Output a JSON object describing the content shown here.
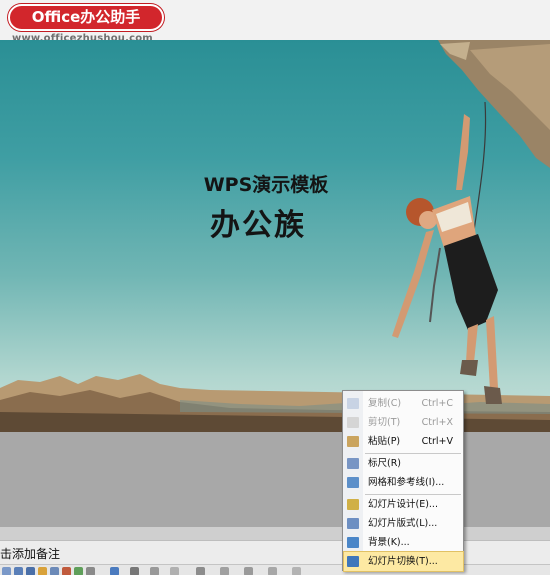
{
  "watermark": {
    "badge": "Office办公助手",
    "url": "www.officezhushou.com"
  },
  "slide": {
    "title": "WPS演示模板",
    "subtitle": "办公族"
  },
  "notes": {
    "placeholder": "击添加备注"
  },
  "context_menu": {
    "items": [
      {
        "label": "复制(C)",
        "shortcut": "Ctrl+C",
        "enabled": false,
        "icon": "copy-icon"
      },
      {
        "label": "剪切(T)",
        "shortcut": "Ctrl+X",
        "enabled": false,
        "icon": "cut-icon"
      },
      {
        "label": "粘贴(P)",
        "shortcut": "Ctrl+V",
        "enabled": true,
        "icon": "paste-icon"
      },
      {
        "label": "标尺(R)",
        "shortcut": "",
        "enabled": true,
        "icon": "ruler-icon"
      },
      {
        "label": "网格和参考线(I)...",
        "shortcut": "",
        "enabled": true,
        "icon": "grid-icon"
      },
      {
        "label": "幻灯片设计(E)...",
        "shortcut": "",
        "enabled": true,
        "icon": "slide-design-icon"
      },
      {
        "label": "幻灯片版式(L)...",
        "shortcut": "",
        "enabled": true,
        "icon": "slide-layout-icon"
      },
      {
        "label": "背景(K)...",
        "shortcut": "",
        "enabled": true,
        "icon": "background-icon"
      },
      {
        "label": "幻灯片切换(T)...",
        "shortcut": "",
        "enabled": true,
        "highlighted": true,
        "icon": "slide-transition-icon"
      }
    ]
  }
}
